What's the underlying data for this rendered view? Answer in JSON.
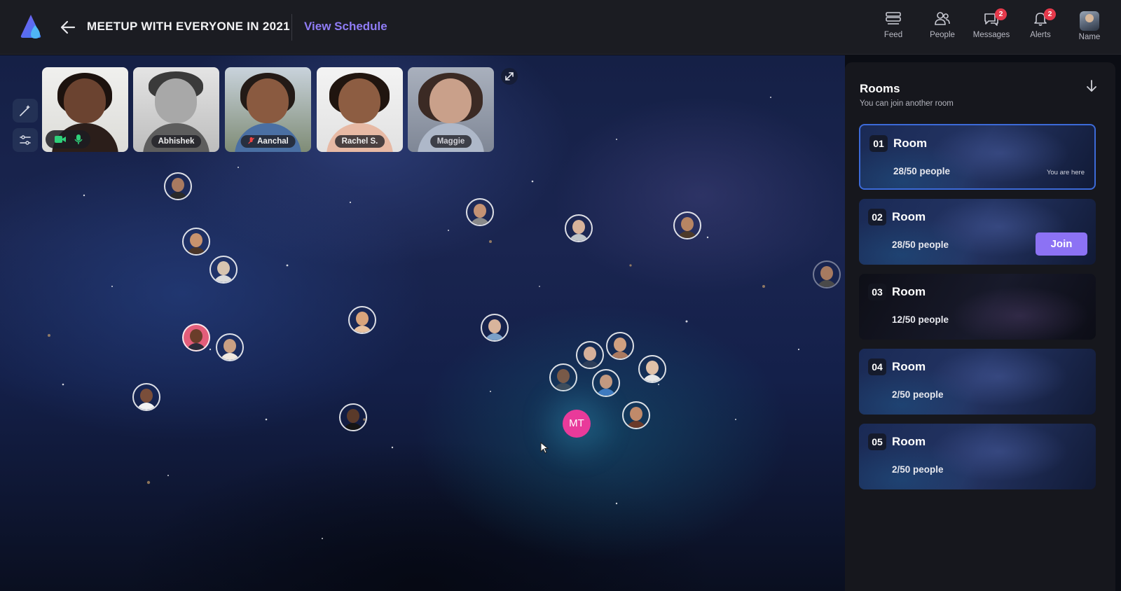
{
  "header": {
    "logo_icon": "app-logo-icon",
    "back_icon": "arrow-left-icon",
    "event_title": "MEETUP WITH EVERYONE IN 2021",
    "schedule_link": "View Schedule",
    "accent_color": "#8f7cf5"
  },
  "nav": {
    "feed": {
      "label": "Feed",
      "icon": "feed-icon"
    },
    "people": {
      "label": "People",
      "icon": "people-icon"
    },
    "messages": {
      "label": "Messages",
      "icon": "messages-icon",
      "badge": "2"
    },
    "alerts": {
      "label": "Alerts",
      "icon": "bell-icon",
      "badge": "2"
    },
    "profile": {
      "label": "Name",
      "icon": "avatar"
    }
  },
  "tools": [
    "magic-wand-icon",
    "sliders-icon"
  ],
  "video_tiles": [
    {
      "label": "",
      "controls": [
        "video-camera-icon",
        "microphone-icon"
      ]
    },
    {
      "label": "Abhishek"
    },
    {
      "label": "Aanchal",
      "muted": true
    },
    {
      "label": "Rachel S."
    },
    {
      "label": "Maggie"
    }
  ],
  "expand_icon": "expand-icon",
  "me": {
    "initials": "MT",
    "color": "#e93a9a"
  },
  "rooms_panel": {
    "title": "Rooms",
    "subtitle": "You can join another room",
    "collapse_icon": "arrow-down-icon",
    "rooms": [
      {
        "number": "01",
        "name": "Room",
        "count": "28/50 people",
        "status": "You are here"
      },
      {
        "number": "02",
        "name": "Room",
        "count": "28/50 people",
        "action": "Join"
      },
      {
        "number": "03",
        "name": "Room",
        "count": "12/50 people"
      },
      {
        "number": "04",
        "name": "Room",
        "count": "2/50 people"
      },
      {
        "number": "05",
        "name": "Room",
        "count": "2/50 people"
      }
    ]
  }
}
